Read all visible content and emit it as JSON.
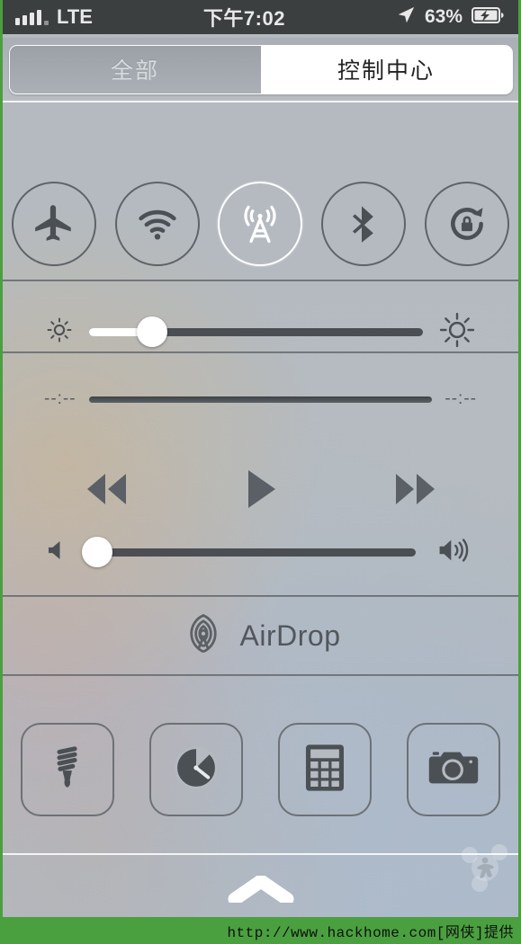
{
  "status_bar": {
    "signal_icon": "signal-bars-icon",
    "carrier": "LTE",
    "time": "下午7:02",
    "location_icon": "location-arrow-icon",
    "battery_percent": "63%",
    "battery_icon": "battery-charging-icon"
  },
  "segmented_control": {
    "tabs": [
      {
        "label": "全部",
        "selected": false
      },
      {
        "label": "控制中心",
        "selected": true
      }
    ]
  },
  "control_center": {
    "toggles": [
      {
        "name": "airplane-mode",
        "icon": "airplane-icon",
        "active": false
      },
      {
        "name": "wifi",
        "icon": "wifi-icon",
        "active": false
      },
      {
        "name": "cellular-data",
        "icon": "cell-tower-icon",
        "active": true
      },
      {
        "name": "bluetooth",
        "icon": "bluetooth-icon",
        "active": false
      },
      {
        "name": "rotation-lock",
        "icon": "rotation-lock-icon",
        "active": false
      }
    ],
    "brightness": {
      "min_icon": "sun-small-icon",
      "max_icon": "sun-large-icon",
      "value_percent": 19
    },
    "playback": {
      "elapsed_time": "--:--",
      "remaining_time": "--:--",
      "progress_percent": 0,
      "buttons": [
        {
          "name": "rewind-button",
          "icon": "rewind-icon"
        },
        {
          "name": "play-button",
          "icon": "play-icon"
        },
        {
          "name": "fast-forward-button",
          "icon": "fast-forward-icon"
        }
      ]
    },
    "volume": {
      "min_icon": "speaker-mute-icon",
      "max_icon": "speaker-loud-icon",
      "value_percent": 2
    },
    "airdrop": {
      "icon": "airdrop-icon",
      "label": "AirDrop"
    },
    "shortcuts": [
      {
        "name": "flashlight",
        "icon": "flashlight-icon"
      },
      {
        "name": "timer",
        "icon": "timer-icon"
      },
      {
        "name": "calculator",
        "icon": "calculator-icon"
      },
      {
        "name": "camera",
        "icon": "camera-icon"
      }
    ],
    "grabber_icon": "chevron-up-grabber-icon",
    "watermark_icon": "site-watermark-logo"
  },
  "footer": {
    "text": "http://www.hackhome.com[网侠]提供"
  },
  "colors": {
    "accent_green": "#4aa03f",
    "status_bar_bg": "#3b3f3f",
    "panel_bg": "#b4bac0",
    "icon_dark": "#4b5054",
    "active_white": "#ffffff"
  }
}
